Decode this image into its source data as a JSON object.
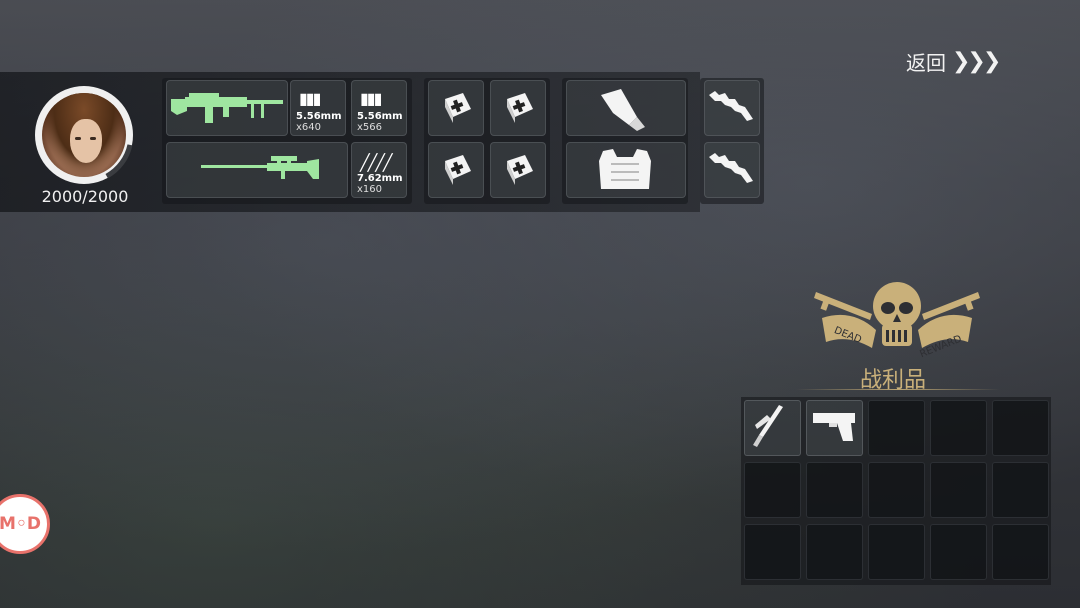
{
  "header": {
    "back_label": "返回",
    "back_chevrons": "❯❯❯"
  },
  "player": {
    "hp_text": "2000/2000",
    "avatar_icon": "female-soldier-portrait"
  },
  "weapons": {
    "row1": {
      "gun_icon": "machine-gun-icon",
      "gun_color": "#9fe6a0",
      "ammo": [
        {
          "caliber": "5.56mm",
          "count": "x640"
        },
        {
          "caliber": "5.56mm",
          "count": "x566"
        }
      ]
    },
    "row2": {
      "gun_icon": "sniper-rifle-icon",
      "gun_color": "#9fe6a0",
      "ammo": [
        {
          "caliber": "7.62mm",
          "count": "x160"
        }
      ]
    }
  },
  "supplies": {
    "medkit_count": 4,
    "medkit_icon": "medkit-icon"
  },
  "gear": {
    "tool_icon": "flashlight-icon",
    "armor_icon": "body-armor-icon",
    "melee_icon": "jagged-blade-icon"
  },
  "loot": {
    "title": "战利品",
    "emblem_banner_left": "DEAD",
    "emblem_banner_right": "REWARD",
    "items": [
      {
        "icon": "knife-icon"
      },
      {
        "icon": "pistol-icon"
      }
    ],
    "accent": "#c9b07a"
  },
  "mod_badge": {
    "label": "M◦D"
  }
}
